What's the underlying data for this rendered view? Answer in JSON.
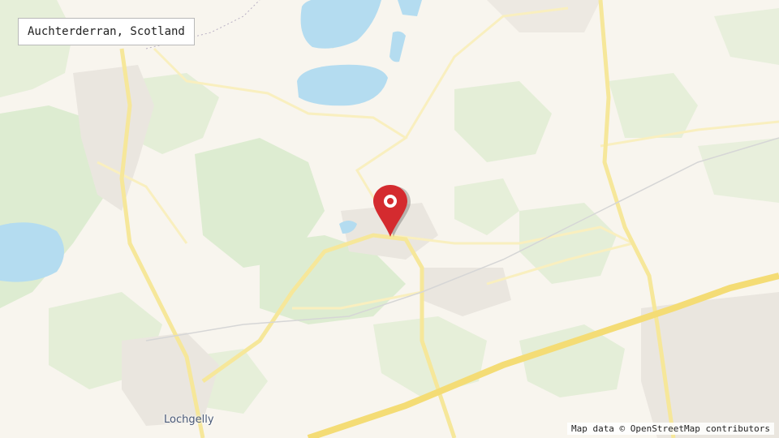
{
  "map": {
    "title": "Auchterderran, Scotland",
    "attribution": "Map data ©  OpenStreetMap contributors",
    "place_labels": [
      "Lochgelly"
    ],
    "marker": {
      "icon": "map-pin-icon",
      "color": "#d42b2f"
    },
    "colors": {
      "background": "#f8f5ee",
      "woodland": "#dcebcf",
      "water": "#b4dcf0",
      "major_road": "#f6e79a",
      "minor_road": "#f9efbf",
      "urban": "#eae6df"
    }
  }
}
